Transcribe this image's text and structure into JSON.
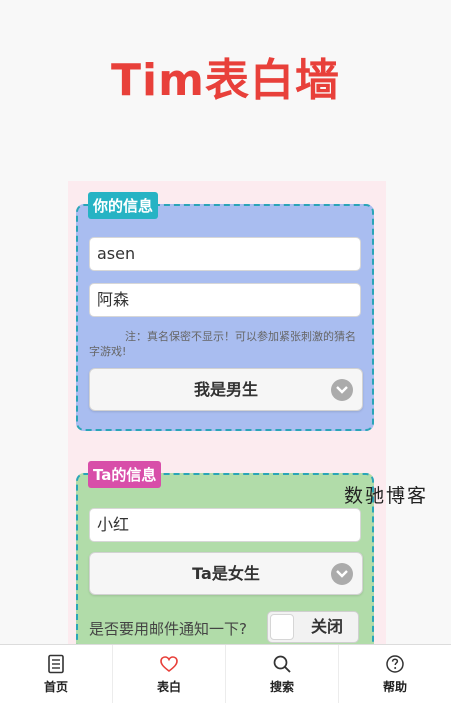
{
  "header": {
    "title": "Tim表白墙"
  },
  "my_info": {
    "legend": "你的信息",
    "name_value": "asen",
    "real_name_value": "阿森",
    "note": "注：真名保密不显示！可以参加紧张刺激的猜名字游戏!",
    "gender_select": "我是男生"
  },
  "ta_info": {
    "legend": "Ta的信息",
    "name_value": "小红",
    "gender_select": "Ta是女生",
    "notify_label": "是否要用邮件通知一下?",
    "notify_toggle": "关闭"
  },
  "watermark": "数驰博客",
  "navbar": {
    "items": [
      {
        "label": "首页",
        "icon": "document-icon"
      },
      {
        "label": "表白",
        "icon": "heart-icon"
      },
      {
        "label": "搜索",
        "icon": "search-icon"
      },
      {
        "label": "帮助",
        "icon": "help-icon"
      }
    ]
  },
  "colors": {
    "title": "#e8403a",
    "my_panel": "#a9bdf0",
    "ta_panel": "#b1dca9",
    "my_legend": "#26b3c4",
    "ta_legend": "#d84ea9",
    "heart_active": "#e8403a"
  }
}
